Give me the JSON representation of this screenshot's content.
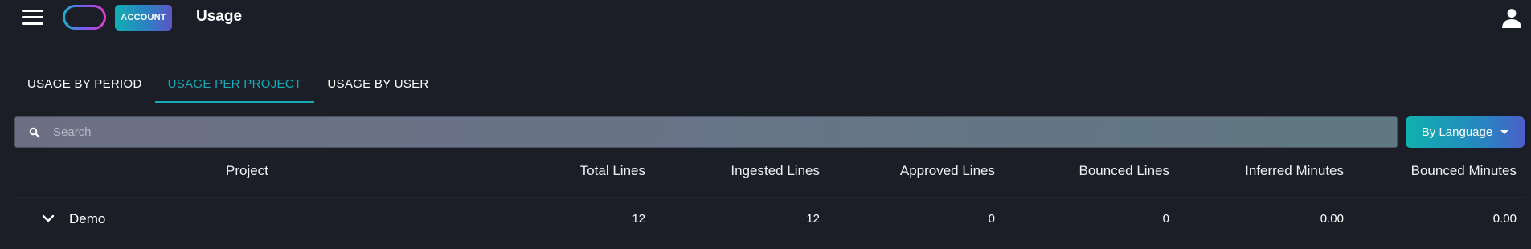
{
  "header": {
    "account_label": "ACCOUNT",
    "title": "Usage",
    "icons": {
      "menu": "hamburger-menu-icon",
      "user": "user-icon"
    }
  },
  "tabs": [
    {
      "label": "USAGE BY PERIOD",
      "active": false
    },
    {
      "label": "USAGE PER PROJECT",
      "active": true
    },
    {
      "label": "USAGE BY USER",
      "active": false
    }
  ],
  "search": {
    "placeholder": "Search",
    "value": ""
  },
  "group_by": {
    "label": "By Language"
  },
  "table": {
    "columns": [
      "Project",
      "Total Lines",
      "Ingested Lines",
      "Approved Lines",
      "Bounced Lines",
      "Inferred Minutes",
      "Bounced Minutes"
    ],
    "rows": [
      {
        "project": "Demo",
        "total_lines": "12",
        "ingested_lines": "12",
        "approved_lines": "0",
        "bounced_lines": "0",
        "inferred_minutes": "0.00",
        "bounced_minutes": "0.00"
      }
    ]
  },
  "colors": {
    "background": "#1b1e26",
    "accent": "#15aab6",
    "text": "#ffffff"
  }
}
